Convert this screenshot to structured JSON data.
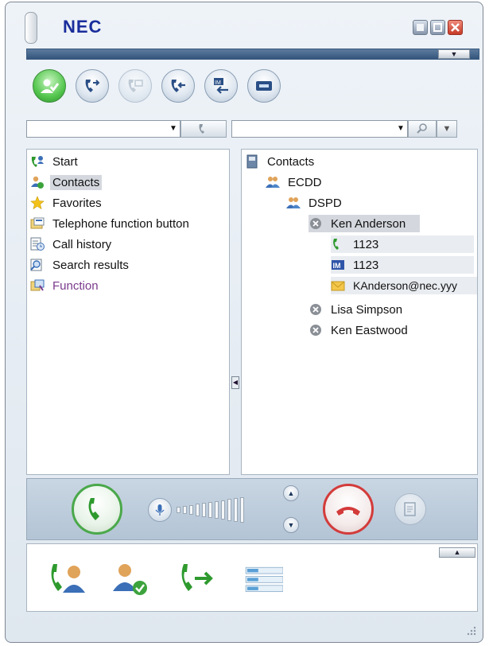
{
  "app": {
    "brand": "NEC",
    "window_buttons": {
      "minimize": "",
      "maximize": "",
      "close": ""
    },
    "collapse_arrow": "▼",
    "expand_arrow": "▲"
  },
  "toolbar": {
    "buttons": [
      {
        "icon": "presence-status-icon",
        "state": "active"
      },
      {
        "icon": "call-forward-icon",
        "state": "enabled"
      },
      {
        "icon": "phone-disabled-icon",
        "state": "disabled"
      },
      {
        "icon": "call-back-icon",
        "state": "enabled"
      },
      {
        "icon": "im-incoming-icon",
        "state": "enabled"
      },
      {
        "icon": "voicemail-icon",
        "state": "enabled"
      }
    ]
  },
  "left_combo": {
    "value": ""
  },
  "right_combo": {
    "value": ""
  },
  "nav": {
    "items": [
      {
        "label": "Start",
        "icon": "start-icon"
      },
      {
        "label": "Contacts",
        "icon": "contacts-icon",
        "selected": true
      },
      {
        "label": "Favorites",
        "icon": "star-icon"
      },
      {
        "label": "Telephone function button",
        "icon": "phone-function-icon"
      },
      {
        "label": "Call history",
        "icon": "call-history-icon"
      },
      {
        "label": "Search results",
        "icon": "search-results-icon"
      },
      {
        "label": "Function",
        "icon": "function-icon"
      }
    ]
  },
  "tree": {
    "root": "Contacts",
    "group1": "ECDD",
    "group2": "DSPD",
    "contacts": [
      {
        "name": "Ken Anderson",
        "phone": "1123",
        "im": "1123",
        "email": "KAnderson@nec.yyy"
      },
      {
        "name": "Lisa Simpson"
      },
      {
        "name": "Ken Eastwood"
      }
    ]
  },
  "callbar": {
    "volume_level": 0,
    "volume_bars": 11
  },
  "colors": {
    "accent_blue": "#34557c",
    "answer_green": "#2e9a2e",
    "hangup_red": "#d33b3b",
    "function_purple": "#7a3a8c"
  }
}
